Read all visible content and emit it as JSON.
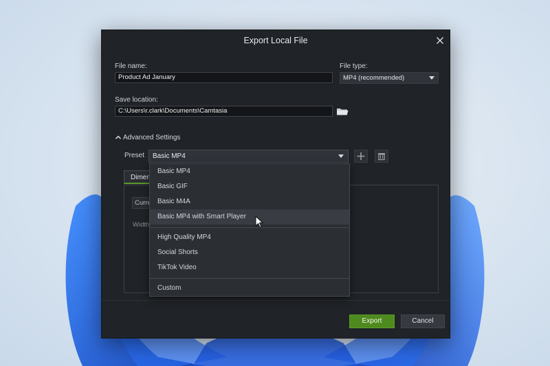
{
  "dialog": {
    "title": "Export Local File",
    "file_name_label": "File name:",
    "file_name_value": "Product Ad January",
    "file_type_label": "File type:",
    "file_type_value": "MP4 (recommended)",
    "save_location_label": "Save location:",
    "save_location_value": "C:\\Users\\r.clark\\Documents\\Camtasia",
    "advanced_settings_label": "Advanced Settings",
    "preset_label": "Preset",
    "preset_value": "Basic MP4",
    "tab_label": "Dimensions",
    "panel_field_text": "Current",
    "panel_width_label": "Width",
    "export_label": "Export",
    "cancel_label": "Cancel"
  },
  "preset_dropdown": {
    "group1": [
      "Basic MP4",
      "Basic GIF",
      "Basic M4A",
      "Basic MP4 with Smart Player"
    ],
    "group2": [
      "High Quality MP4",
      "Social Shorts",
      "TikTok Video"
    ],
    "group3": [
      "Custom"
    ],
    "hovered_item": "Basic MP4 with Smart Player"
  },
  "icons": {
    "close": "close-icon",
    "folder": "folder-icon",
    "chevron": "chevron-up-icon",
    "add": "plus-icon",
    "delete": "trash-icon",
    "pointer": "mouse-pointer-icon"
  },
  "colors": {
    "accent_green": "#4f8a1f",
    "dialog_bg": "#202327",
    "wallpaper_blue": "#1f5fe0"
  }
}
